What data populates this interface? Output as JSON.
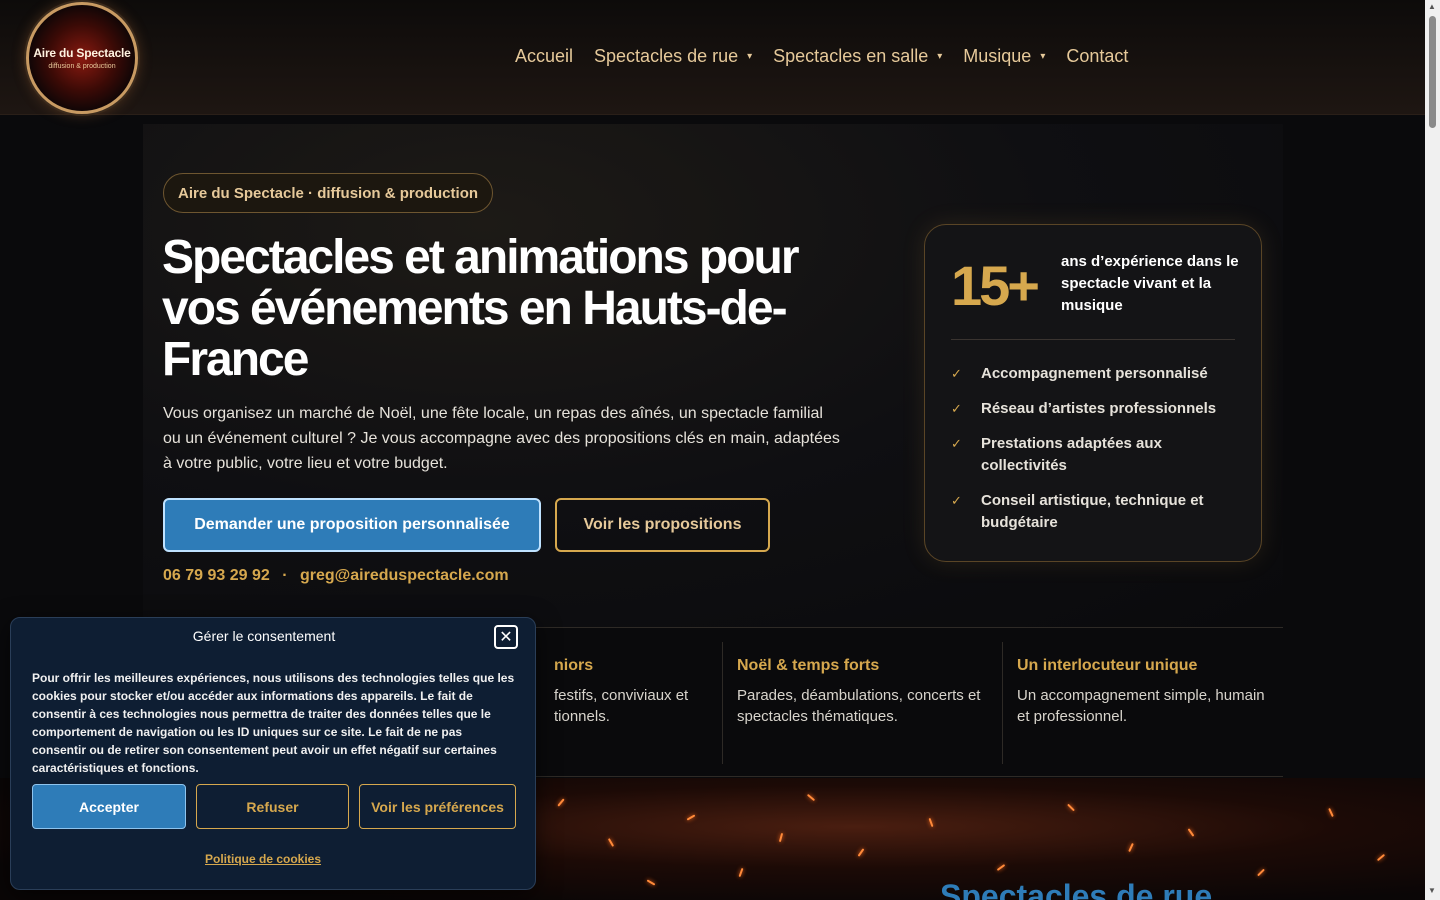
{
  "header": {
    "logo": {
      "title": "Aire du Spectacle",
      "subtitle": "diffusion & production"
    },
    "nav": [
      {
        "label": "Accueil",
        "has_dropdown": false
      },
      {
        "label": "Spectacles de rue",
        "has_dropdown": true
      },
      {
        "label": "Spectacles en salle",
        "has_dropdown": true
      },
      {
        "label": "Musique",
        "has_dropdown": true
      },
      {
        "label": "Contact",
        "has_dropdown": false
      }
    ]
  },
  "hero": {
    "badge": "Aire du Spectacle · diffusion & production",
    "title": "Spectacles et animations pour vos événements en Hauts-de-France",
    "text": "Vous organisez un marché de Noël, une fête locale, un repas des aînés, un spectacle familial ou un événement culturel ? Je vous accompagne avec des propositions clés en main, adaptées à votre public, votre lieu et votre budget.",
    "primary_button": "Demander une proposition personnalisée",
    "secondary_button": "Voir les propositions",
    "phone": "06 79 93 29 92",
    "separator": "·",
    "email": "greg@aireduspectacle.com"
  },
  "experience_card": {
    "number": "15+",
    "text": "ans d’expérience dans le spectacle vivant et la musique",
    "items": [
      "Accompagnement personnalisé",
      "Réseau d’artistes professionnels",
      "Prestations adaptées aux collectivités",
      "Conseil artistique, technique et budgétaire"
    ]
  },
  "features": [
    {
      "title": "",
      "text": ""
    },
    {
      "title": "niors",
      "text": "festifs, conviviaux et tionnels."
    },
    {
      "title": "Noël & temps forts",
      "text": "Parades, déambulations, concerts et spectacles thématiques."
    },
    {
      "title": "Un interlocuteur unique",
      "text": "Un accompagnement simple, humain et professionnel."
    }
  ],
  "sparks_section": {
    "title": "Spectacles de rue"
  },
  "cookie_banner": {
    "title": "Gérer le consentement",
    "body": "Pour offrir les meilleures expériences, nous utilisons des technologies telles que les cookies pour stocker et/ou accéder aux informations des appareils. Le fait de consentir à ces technologies nous permettra de traiter des données telles que le comportement de navigation ou les ID uniques sur ce site. Le fait de ne pas consentir ou de retirer son consentement peut avoir un effet négatif sur certaines caractéristiques et fonctions.",
    "accept": "Accepter",
    "refuse": "Refuser",
    "preferences": "Voir les préférences",
    "policy_link": "Politique de cookies"
  },
  "colors": {
    "accent_gold": "#d6a84e",
    "primary_blue": "#2e7cb8",
    "background": "#0a0a0c",
    "cookie_bg": "#0e1e33"
  },
  "icons": {
    "check": "✓",
    "caret": "▾",
    "close": "✕"
  }
}
